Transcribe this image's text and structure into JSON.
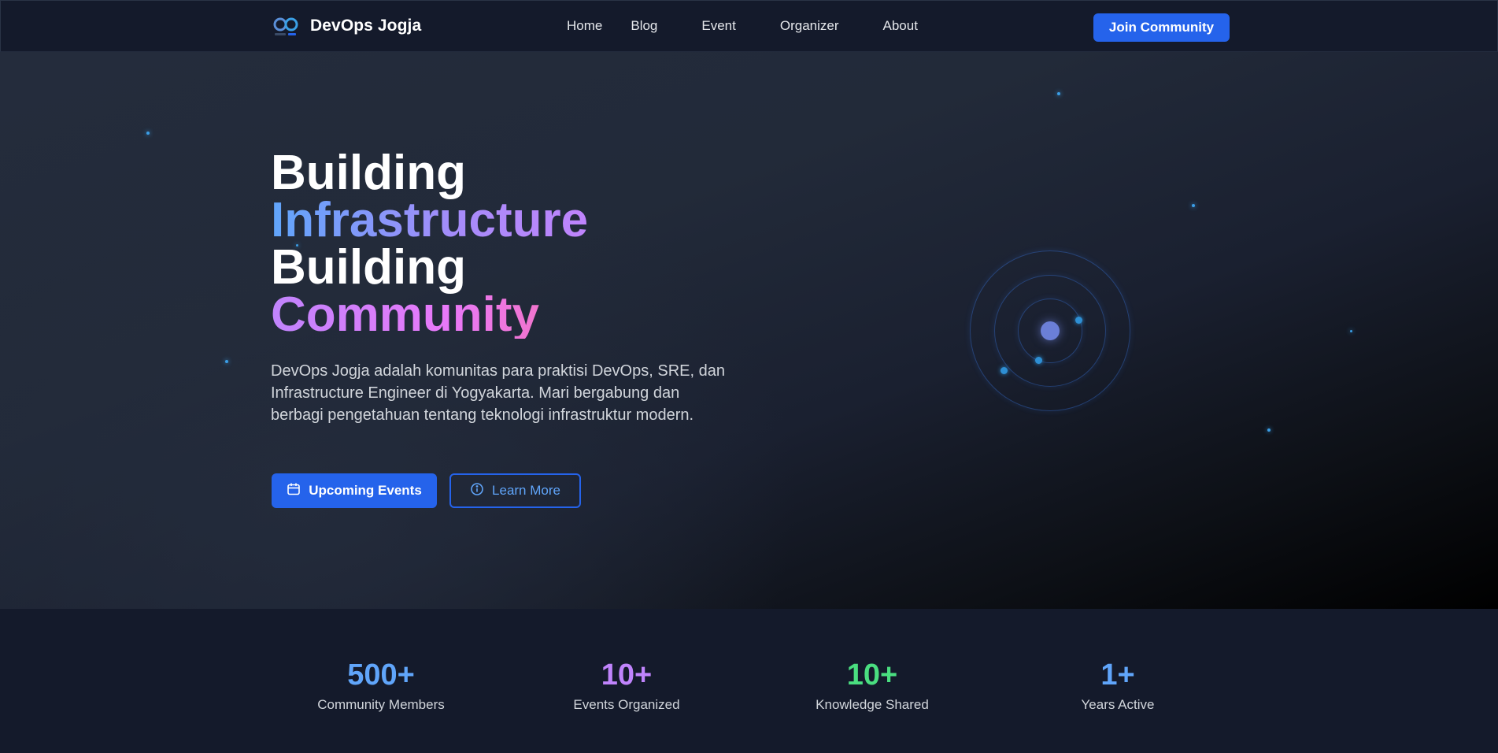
{
  "nav": {
    "brand": "DevOps Jogja",
    "links": [
      "Home",
      "Blog",
      "Event",
      "Organizer",
      "About"
    ],
    "cta": "Join Community"
  },
  "hero": {
    "title_line1": "Building",
    "title_line2": "Infrastructure",
    "title_line3": "Building",
    "title_line4": "Community",
    "description": "DevOps Jogja adalah komunitas para praktisi DevOps, SRE, dan Infrastructure Engineer di Yogyakarta. Mari bergabung dan berbagi pengetahuan tentang teknologi infrastruktur modern.",
    "primary_button": "Upcoming Events",
    "secondary_button": "Learn More"
  },
  "stats": [
    {
      "value": "500+",
      "label": "Community Members",
      "color": "#60a5fa"
    },
    {
      "value": "10+",
      "label": "Events Organized",
      "color": "#c084fc"
    },
    {
      "value": "10+",
      "label": "Knowledge Shared",
      "color": "#4ade80"
    },
    {
      "value": "1+",
      "label": "Years Active",
      "color": "#60a5fa"
    }
  ],
  "colors": {
    "accent": "#2563eb",
    "background": "#141a2b"
  }
}
